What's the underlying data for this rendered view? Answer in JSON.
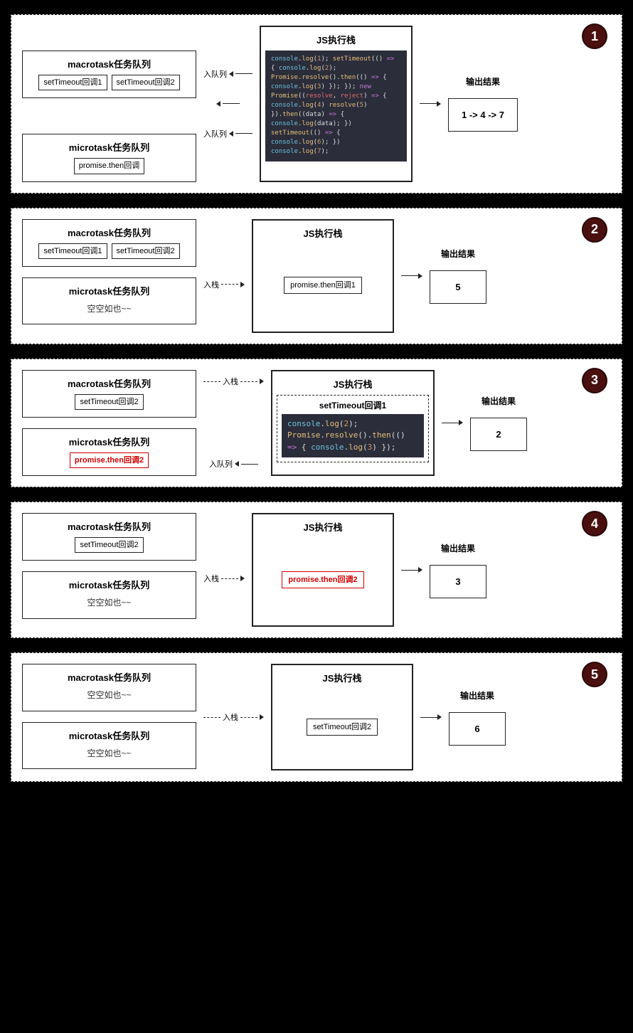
{
  "labels": {
    "macrotask_title": "macrotask任务队列",
    "microtask_title": "microtask任务队列",
    "stack_title": "JS执行栈",
    "enqueue": "入队列",
    "enstack": "入栈",
    "output": "输出结果",
    "empty": "空空如也~~",
    "settimeout_cb1": "setTimeout回调1",
    "settimeout_cb2": "setTimeout回调2",
    "promise_then_cb": "promise.then回调",
    "promise_then_cb1": "promise.then回调1",
    "promise_then_cb2": "promise.then回调2"
  },
  "panels": [
    {
      "n": "1",
      "out": "1 -> 4 -> 7"
    },
    {
      "n": "2",
      "out": "5"
    },
    {
      "n": "3",
      "out": "2"
    },
    {
      "n": "4",
      "out": "3"
    },
    {
      "n": "5",
      "out": "6"
    }
  ],
  "code1": {
    "lines": [
      "console.log(1);",
      "",
      "setTimeout(() => {",
      "  console.log(2);",
      "  Promise.resolve().then(() => {",
      "    console.log(3)",
      "  });",
      "});",
      "",
      "new Promise((resolve, reject) => {",
      "  console.log(4)",
      "  resolve(5)",
      "}).then((data) => {",
      "  console.log(data);",
      "})",
      "",
      "setTimeout(() => {",
      "  console.log(6);",
      "})",
      "",
      "console.log(7);"
    ]
  },
  "code3": {
    "title": "setTimeout回调1",
    "lines": [
      "console.log(2);",
      "Promise.resolve().then(() => {",
      "  console.log(3)",
      "});"
    ]
  }
}
